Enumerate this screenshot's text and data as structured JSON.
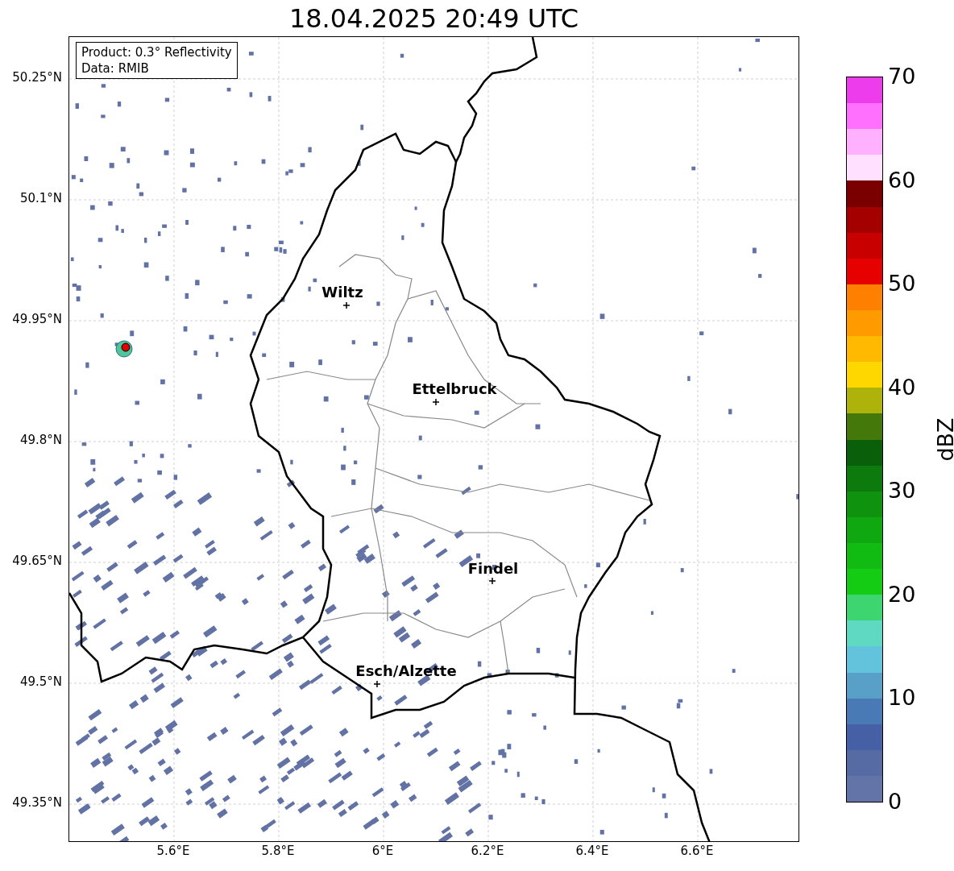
{
  "title": "18.04.2025 20:49 UTC",
  "info_box": [
    "Product: 0.3° Reflectivity",
    "Data: RMIB"
  ],
  "y_ticks": [
    "50.25°N",
    "50.1°N",
    "49.95°N",
    "49.8°N",
    "49.65°N",
    "49.5°N",
    "49.35°N"
  ],
  "x_ticks": [
    "5.6°E",
    "5.8°E",
    "6°E",
    "6.2°E",
    "6.4°E",
    "6.6°E"
  ],
  "cities": [
    {
      "name": "Wiltz"
    },
    {
      "name": "Ettelbruck"
    },
    {
      "name": "Findel"
    },
    {
      "name": "Esch/Alzette"
    }
  ],
  "colorbar": {
    "label": "dBZ",
    "ticks": [
      "70",
      "60",
      "50",
      "40",
      "30",
      "20",
      "10",
      "0"
    ],
    "levels": [
      {
        "color": "#ec3cec"
      },
      {
        "color": "#ff70ff"
      },
      {
        "color": "#ffb0ff"
      },
      {
        "color": "#ffe0ff"
      },
      {
        "color": "#7a0000"
      },
      {
        "color": "#a50000"
      },
      {
        "color": "#c80000"
      },
      {
        "color": "#e60000"
      },
      {
        "color": "#ff7f00"
      },
      {
        "color": "#ff9b00"
      },
      {
        "color": "#ffba00"
      },
      {
        "color": "#ffd700"
      },
      {
        "color": "#adb30a"
      },
      {
        "color": "#44780a"
      },
      {
        "color": "#0a600a"
      },
      {
        "color": "#0c7a0c"
      },
      {
        "color": "#0f930f"
      },
      {
        "color": "#10a810"
      },
      {
        "color": "#12bb12"
      },
      {
        "color": "#14cc14"
      },
      {
        "color": "#3dd570"
      },
      {
        "color": "#5fd9c2"
      },
      {
        "color": "#63c3dc"
      },
      {
        "color": "#59a0c9"
      },
      {
        "color": "#4a7ab5"
      },
      {
        "color": "#4560a5"
      },
      {
        "color": "#566aa4"
      },
      {
        "color": "#6374a8"
      }
    ]
  }
}
